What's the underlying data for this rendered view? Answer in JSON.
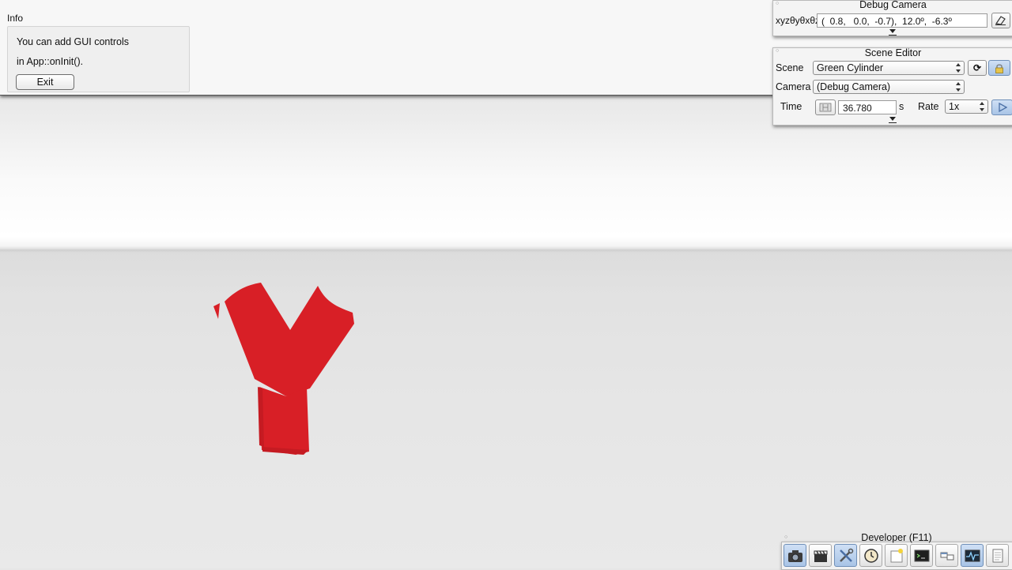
{
  "info": {
    "title": "Info",
    "line1": "You can add GUI controls",
    "line2": "in App::onInit().",
    "exit_label": "Exit"
  },
  "debug_camera": {
    "title": "Debug Camera",
    "field_label": "xyzθyθxθz",
    "value": "(  0.8,   0.0,  -0.7),  12.0º,  -6.3º"
  },
  "scene_editor": {
    "title": "Scene Editor",
    "scene_label": "Scene",
    "scene_value": "Green Cylinder",
    "camera_label": "Camera",
    "camera_value": "(Debug Camera)",
    "time_label": "Time",
    "time_value": "36.780",
    "time_unit": "s",
    "rate_label": "Rate",
    "rate_value": "1x"
  },
  "developer": {
    "title": "Developer (F11)",
    "buttons": [
      "camera-icon",
      "clapperboard-icon",
      "tools-icon",
      "clock-icon",
      "new-document-icon",
      "terminal-icon",
      "windows-icon",
      "profiler-icon",
      "document-icon"
    ]
  },
  "colors": {
    "model": "#d81f26",
    "active_button": "#a9c4e6"
  }
}
